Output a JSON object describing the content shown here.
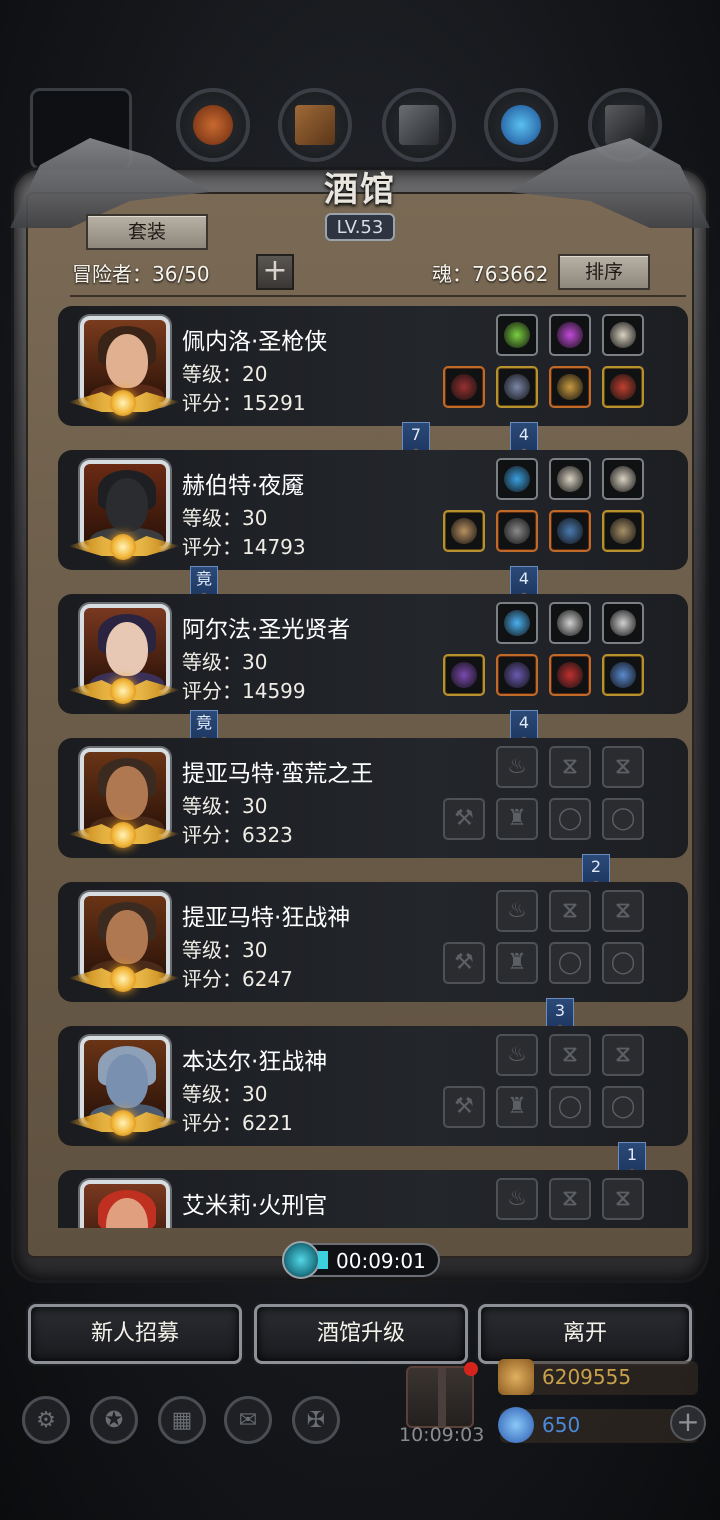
{
  "header": {
    "title": "酒馆",
    "level": "LV.53",
    "suit_button": "套装",
    "adventurers_label": "冒险者：36/50",
    "plus_button": "+",
    "soul_label": "魂：763662",
    "sort_button": "排序"
  },
  "top_tabs": [
    "slot-empty",
    "wood-round-icon",
    "wood-plank-icon",
    "iron-ingot-icon",
    "blue-crystal-icon",
    "dark-ore-icon"
  ],
  "heroes": [
    {
      "name": "佩内洛·圣枪侠",
      "level": "等级：20",
      "score": "评分：15291",
      "ribbon_left": "7",
      "ribbon_right": "4",
      "top_slots": [
        {
          "type": "green-gem-icon",
          "color": "#7ad040",
          "rarity": "grey"
        },
        {
          "type": "purple-gem-icon",
          "color": "#c24ad8",
          "rarity": "grey"
        },
        {
          "type": "claw-icon",
          "color": "#d9d2c2",
          "rarity": "grey"
        }
      ],
      "bottom_slots": [
        {
          "type": "spear-icon",
          "color": "#9a3030",
          "rarity": "orange"
        },
        {
          "type": "armor-icon",
          "color": "#7a86a8",
          "rarity": "gold"
        },
        {
          "type": "ring-icon",
          "color": "#c89a40",
          "rarity": "orange"
        },
        {
          "type": "necklace-icon",
          "color": "#c04030",
          "rarity": "gold"
        }
      ]
    },
    {
      "name": "赫伯特·夜魇",
      "level": "等级：30",
      "score": "评分：14793",
      "ribbon_left": "竟",
      "ribbon_right": "4",
      "top_slots": [
        {
          "type": "blue-orb-icon",
          "color": "#3aa0e0",
          "rarity": "grey"
        },
        {
          "type": "claw-icon",
          "color": "#d9d2c2",
          "rarity": "grey"
        },
        {
          "type": "claw-icon",
          "color": "#d9d2c2",
          "rarity": "grey"
        }
      ],
      "bottom_slots": [
        {
          "type": "bow-icon",
          "color": "#b89060",
          "rarity": "gold"
        },
        {
          "type": "armor-icon",
          "color": "#8a8a8a",
          "rarity": "orange"
        },
        {
          "type": "necklace-icon",
          "color": "#4a7ab0",
          "rarity": "orange"
        },
        {
          "type": "ring-icon",
          "color": "#a89068",
          "rarity": "gold"
        }
      ]
    },
    {
      "name": "阿尔法·圣光贤者",
      "level": "等级：30",
      "score": "评分：14599",
      "ribbon_left": "竟",
      "ribbon_right": "4",
      "top_slots": [
        {
          "type": "blue-orb-icon",
          "color": "#4ab0f0",
          "rarity": "grey"
        },
        {
          "type": "rune-icon",
          "color": "#d0d0d0",
          "rarity": "grey"
        },
        {
          "type": "feather-icon",
          "color": "#d0d0d0",
          "rarity": "grey"
        }
      ],
      "bottom_slots": [
        {
          "type": "staff-icon",
          "color": "#7a4ab0",
          "rarity": "gold"
        },
        {
          "type": "armor-icon",
          "color": "#6a5ab0",
          "rarity": "orange"
        },
        {
          "type": "ring-icon",
          "color": "#c03030",
          "rarity": "orange"
        },
        {
          "type": "necklace-icon",
          "color": "#5a8ad0",
          "rarity": "gold"
        }
      ]
    },
    {
      "name": "提亚马特·蛮荒之王",
      "level": "等级：30",
      "score": "评分：6323",
      "ribbon_right": "2"
    },
    {
      "name": "提亚马特·狂战神",
      "level": "等级：30",
      "score": "评分：6247",
      "ribbon_right": "3"
    },
    {
      "name": "本达尔·狂战神",
      "level": "等级：30",
      "score": "评分：6221",
      "ribbon_right": "1"
    },
    {
      "name": "艾米莉·火刑官",
      "level": "",
      "score": ""
    }
  ],
  "timer": "00:09:01",
  "bottom_buttons": {
    "recruit": "新人招募",
    "upgrade": "酒馆升级",
    "leave": "离开"
  },
  "gift_timer": "10:09:03",
  "resources": {
    "gold": "6209555",
    "gems": "650",
    "gold_color": "#c9a14a",
    "gem_color": "#4a8ad8"
  }
}
